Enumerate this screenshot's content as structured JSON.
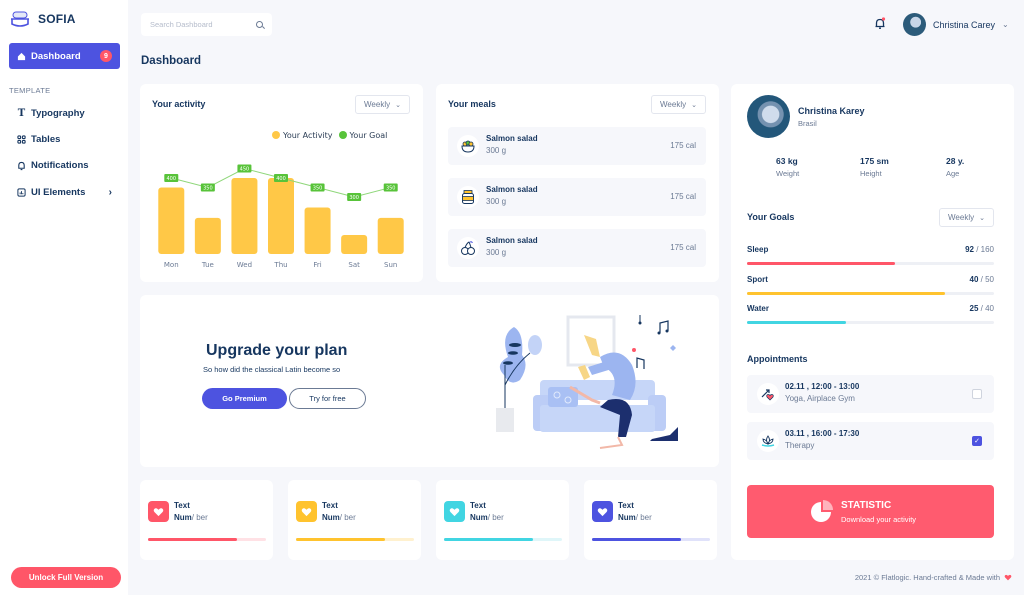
{
  "app": {
    "name": "SOFIA"
  },
  "sidebar": {
    "active": {
      "label": "Dashboard",
      "badge": "9",
      "icon": "home-icon"
    },
    "section_label": "TEMPLATE",
    "items": [
      {
        "label": "Typography",
        "icon": "typography-icon"
      },
      {
        "label": "Tables",
        "icon": "grid-icon"
      },
      {
        "label": "Notifications",
        "icon": "bell-icon"
      },
      {
        "label": "UI Elements",
        "icon": "chart-box-icon",
        "has_submenu": true
      }
    ],
    "unlock_label": "Unlock Full Version"
  },
  "header": {
    "search_placeholder": "Search Dashboard",
    "user_name": "Christina Carey",
    "notification_dot": true
  },
  "page_title": "Dashboard",
  "activity": {
    "title": "Your activity",
    "period": "Weekly",
    "legend": [
      "Your Activity",
      "Your Goal"
    ]
  },
  "chart_data": {
    "type": "bar",
    "title": "Your activity",
    "categories": [
      "Mon",
      "Tue",
      "Wed",
      "Thu",
      "Fri",
      "Sat",
      "Sun"
    ],
    "series": [
      {
        "name": "Your Activity",
        "type": "bar",
        "color": "#ffc847",
        "values": [
          350,
          190,
          400,
          400,
          245,
          100,
          190
        ]
      },
      {
        "name": "Your Goal",
        "type": "line",
        "color": "#58c33a",
        "values": [
          400,
          350,
          450,
          400,
          350,
          300,
          350
        ]
      }
    ],
    "ylim": [
      0,
      600
    ],
    "grid": false,
    "legend": "top-right",
    "xlabel": "",
    "ylabel": ""
  },
  "meals": {
    "title": "Your meals",
    "period": "Weekly",
    "items": [
      {
        "name": "Salmon salad",
        "weight": "300 g",
        "calories": "175 cal",
        "icon": "salad-bowl-icon"
      },
      {
        "name": "Salmon salad",
        "weight": "300 g",
        "calories": "175 cal",
        "icon": "jar-icon"
      },
      {
        "name": "Salmon salad",
        "weight": "300 g",
        "calories": "175 cal",
        "icon": "cherries-icon"
      }
    ]
  },
  "upgrade": {
    "title": "Upgrade your plan",
    "subtitle": "So how did the classical Latin become so",
    "primary_label": "Go Premium",
    "secondary_label": "Try for free"
  },
  "stat_cards": [
    {
      "title": "Text",
      "num": "Num",
      "suffix": "/ ber",
      "color": "#ff5668",
      "light": "#ffe1e5",
      "progress": 0.75
    },
    {
      "title": "Text",
      "num": "Num",
      "suffix": "/ ber",
      "color": "#ffc32e",
      "light": "#fff1cf",
      "progress": 0.75
    },
    {
      "title": "Text",
      "num": "Num",
      "suffix": "/ ber",
      "color": "#41d5e2",
      "light": "#dff6f9",
      "progress": 0.75
    },
    {
      "title": "Text",
      "num": "Num",
      "suffix": "/ ber",
      "color": "#4d53e0",
      "light": "#e0e2fa",
      "progress": 0.75
    }
  ],
  "profile": {
    "name": "Christina Karey",
    "location": "Brasil",
    "metrics": [
      {
        "value": "63 kg",
        "label": "Weight"
      },
      {
        "value": "175 sm",
        "label": "Height"
      },
      {
        "value": "28 y.",
        "label": "Age"
      }
    ]
  },
  "goals": {
    "title": "Your Goals",
    "period": "Weekly",
    "items": [
      {
        "label": "Sleep",
        "value": "92",
        "max": "/ 160",
        "progress": 0.6,
        "color": "#ff5668"
      },
      {
        "label": "Sport",
        "value": "40",
        "max": "/ 50",
        "progress": 0.8,
        "color": "#ffc32e"
      },
      {
        "label": "Water",
        "value": "25",
        "max": "/ 40",
        "progress": 0.4,
        "color": "#41d5e2"
      }
    ]
  },
  "appointments": {
    "title": "Appointments",
    "items": [
      {
        "time": "02.11 , 12:00 - 13:00",
        "place": "Yoga, Airplace Gym",
        "checked": false,
        "icon": "yoga-heart-icon"
      },
      {
        "time": "03.11 , 16:00 - 17:30",
        "place": "Therapy",
        "checked": true,
        "icon": "lotus-icon"
      }
    ]
  },
  "statistic": {
    "title": "STATISTIC",
    "subtitle": "Download your activity"
  },
  "footer": {
    "text": "2021 © Flatlogic. Hand-crafted & Made with"
  }
}
